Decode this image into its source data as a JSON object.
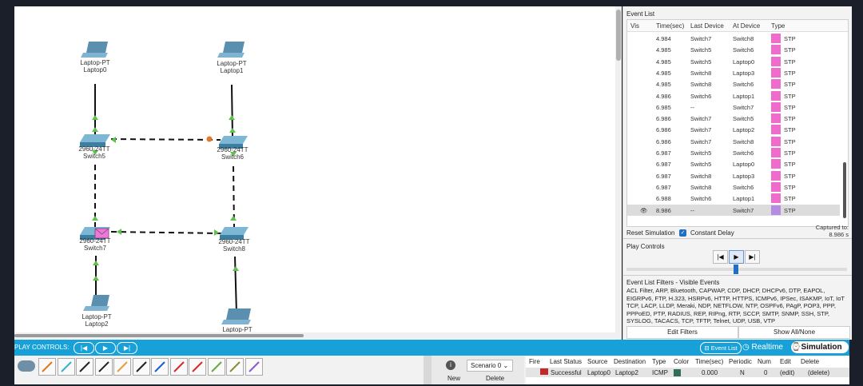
{
  "topology": {
    "devices": [
      {
        "type": "Laptop-PT",
        "name": "Laptop0"
      },
      {
        "type": "Laptop-PT",
        "name": "Laptop1"
      },
      {
        "type": "2960-24TT",
        "name": "Switch5"
      },
      {
        "type": "2960-24TT",
        "name": "Switch6"
      },
      {
        "type": "2960-24TT",
        "name": "Switch7"
      },
      {
        "type": "2960-24TT",
        "name": "Switch8"
      },
      {
        "type": "Laptop-PT",
        "name": "Laptop2"
      },
      {
        "type": "Laptop-PT",
        "name": ""
      }
    ]
  },
  "event_list": {
    "title": "Event List",
    "headers": [
      "Vis",
      "Time(sec)",
      "Last Device",
      "At Device",
      "Type"
    ],
    "rows": [
      {
        "time": "4.984",
        "last": "Switch7",
        "at": "Switch8",
        "type": "STP",
        "color": "#f06ccc"
      },
      {
        "time": "4.985",
        "last": "Switch5",
        "at": "Switch6",
        "type": "STP",
        "color": "#f06ccc"
      },
      {
        "time": "4.985",
        "last": "Switch5",
        "at": "Laptop0",
        "type": "STP",
        "color": "#f06ccc"
      },
      {
        "time": "4.985",
        "last": "Switch8",
        "at": "Laptop3",
        "type": "STP",
        "color": "#f06ccc"
      },
      {
        "time": "4.985",
        "last": "Switch8",
        "at": "Switch6",
        "type": "STP",
        "color": "#f06ccc"
      },
      {
        "time": "4.986",
        "last": "Switch6",
        "at": "Laptop1",
        "type": "STP",
        "color": "#f06ccc"
      },
      {
        "time": "6.985",
        "last": "--",
        "at": "Switch7",
        "type": "STP",
        "color": "#f06ccc"
      },
      {
        "time": "6.986",
        "last": "Switch7",
        "at": "Switch5",
        "type": "STP",
        "color": "#f06ccc"
      },
      {
        "time": "6.986",
        "last": "Switch7",
        "at": "Laptop2",
        "type": "STP",
        "color": "#f06ccc"
      },
      {
        "time": "6.986",
        "last": "Switch7",
        "at": "Switch8",
        "type": "STP",
        "color": "#f06ccc"
      },
      {
        "time": "6.987",
        "last": "Switch5",
        "at": "Switch6",
        "type": "STP",
        "color": "#f06ccc"
      },
      {
        "time": "6.987",
        "last": "Switch5",
        "at": "Laptop0",
        "type": "STP",
        "color": "#f06ccc"
      },
      {
        "time": "6.987",
        "last": "Switch8",
        "at": "Laptop3",
        "type": "STP",
        "color": "#f06ccc"
      },
      {
        "time": "6.987",
        "last": "Switch8",
        "at": "Switch6",
        "type": "STP",
        "color": "#f06ccc"
      },
      {
        "time": "6.988",
        "last": "Switch6",
        "at": "Laptop1",
        "type": "STP",
        "color": "#f06ccc"
      },
      {
        "time": "8.986",
        "last": "--",
        "at": "Switch7",
        "type": "STP",
        "color": "#b48ce0"
      }
    ],
    "selected_row": 15
  },
  "sim_controls": {
    "reset_label": "Reset Simulation",
    "constant_delay_label": "Constant Delay",
    "constant_delay_checked": true,
    "captured_label": "Captured to:",
    "captured_value": "8.986 s"
  },
  "play_controls": {
    "title": "Play Controls",
    "back_symbol": "|◀",
    "play_symbol": "▶",
    "forward_symbol": "▶|"
  },
  "filters": {
    "title": "Event List Filters - Visible Events",
    "text": "ACL Filter, ARP, Bluetooth, CAPWAP, CDP, DHCP, DHCPv6, DTP, EAPOL, EIGRPv6, FTP, H.323, HSRPv6, HTTP, HTTPS, ICMPv6, IPSec, ISAKMP, IoT, IoT TCP, LACP, LLDP, Meraki, NDP, NETFLOW, NTP, OSPFv6, PAgP, POP3, PPP, PPPoED, PTP, RADIUS, REP, RIPng, RTP, SCCP, SMTP, SNMP, SSH, STP, SYSLOG, TACACS, TCP, TFTP, Telnet, UDP, USB, VTP",
    "edit_label": "Edit Filters",
    "show_all_label": "Show All/None"
  },
  "bottom_bar": {
    "play_controls_label": "PLAY CONTROLS:",
    "event_list_label": "Event List",
    "realtime_label": "Realtime",
    "simulation_label": "Simulation"
  },
  "scenario": {
    "select_value": "Scenario 0",
    "new_label": "New",
    "delete_label": "Delete"
  },
  "pdu": {
    "headers": [
      "Fire",
      "Last Status",
      "Source",
      "Destination",
      "Type",
      "Color",
      "Time(sec)",
      "Periodic",
      "Num",
      "Edit",
      "Delete"
    ],
    "row": {
      "status": "Successful",
      "source": "Laptop0",
      "destination": "Laptop2",
      "type": "ICMP",
      "color": "#2f6f5a",
      "time": "0.000",
      "periodic": "N",
      "num": "0",
      "edit": "(edit)",
      "delete": "(delete)"
    }
  },
  "connection_tools": [
    {
      "icon": "lightning-auto-icon",
      "color": "#e0761a"
    },
    {
      "icon": "console-cable-icon",
      "color": "#37b0c8"
    },
    {
      "icon": "straight-through-cable-icon",
      "color": "#222222"
    },
    {
      "icon": "crossover-cable-icon",
      "color": "#222222"
    },
    {
      "icon": "fiber-cable-icon",
      "color": "#e0a040"
    },
    {
      "icon": "phone-cable-icon",
      "color": "#222222"
    },
    {
      "icon": "coaxial-cable-icon",
      "color": "#1d5fd0"
    },
    {
      "icon": "serial-dce-cable-icon",
      "color": "#e0262a"
    },
    {
      "icon": "serial-dte-cable-icon",
      "color": "#e0262a"
    },
    {
      "icon": "octal-cable-icon",
      "color": "#6aa83a"
    },
    {
      "icon": "iot-custom-cable-icon",
      "color": "#8c8c3a"
    },
    {
      "icon": "usb-cable-icon",
      "color": "#8a5cc8"
    }
  ]
}
